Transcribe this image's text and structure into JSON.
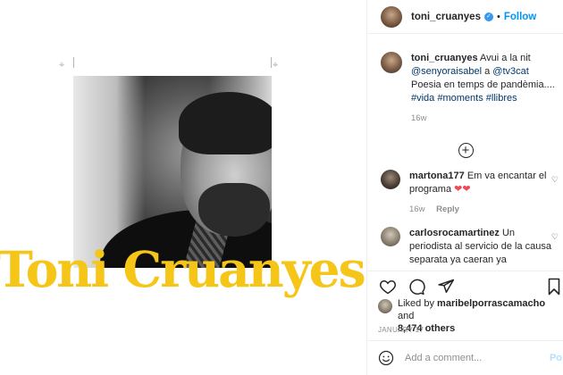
{
  "post": {
    "banner_name": "Toni Cruanyes"
  },
  "header": {
    "username": "toni_cruanyes",
    "separator": "•",
    "follow_label": "Follow"
  },
  "caption": {
    "username": "toni_cruanyes",
    "text_1": "Avui a la nit",
    "mention_1": "@senyoraisabel",
    "text_2": "a",
    "mention_2": "@tv3cat",
    "text_3": "Poesia en temps de pandèmia....",
    "hashtag_1": "#vida",
    "hashtag_2": "#moments",
    "hashtag_3": "#llibres",
    "age": "16w"
  },
  "load_more_icon": "plus-circle-icon",
  "comments": [
    {
      "username": "martona177",
      "text": "Em va encantar el programa",
      "emoji": "❤❤",
      "age": "16w",
      "reply_label": "Reply"
    },
    {
      "username": "carlosrocamartinez",
      "text": "Un periodista al servicio de la causa separata ya caeran ya"
    }
  ],
  "icons": {
    "like": "heart-icon",
    "comment": "comment-icon",
    "share": "paper-plane-icon",
    "save": "bookmark-icon"
  },
  "likes": {
    "prefix": "Liked by",
    "user": "maribelporrascamacho",
    "and": "and",
    "count": "8,474 others"
  },
  "date": "JANUARY 17",
  "add_comment": {
    "placeholder": "Add a comment...",
    "post_label": "Po"
  },
  "colors": {
    "banner_yellow": "#f5c518",
    "link_blue": "#0095f6",
    "mention_blue": "#00376b",
    "heart_red": "#ed4956"
  }
}
